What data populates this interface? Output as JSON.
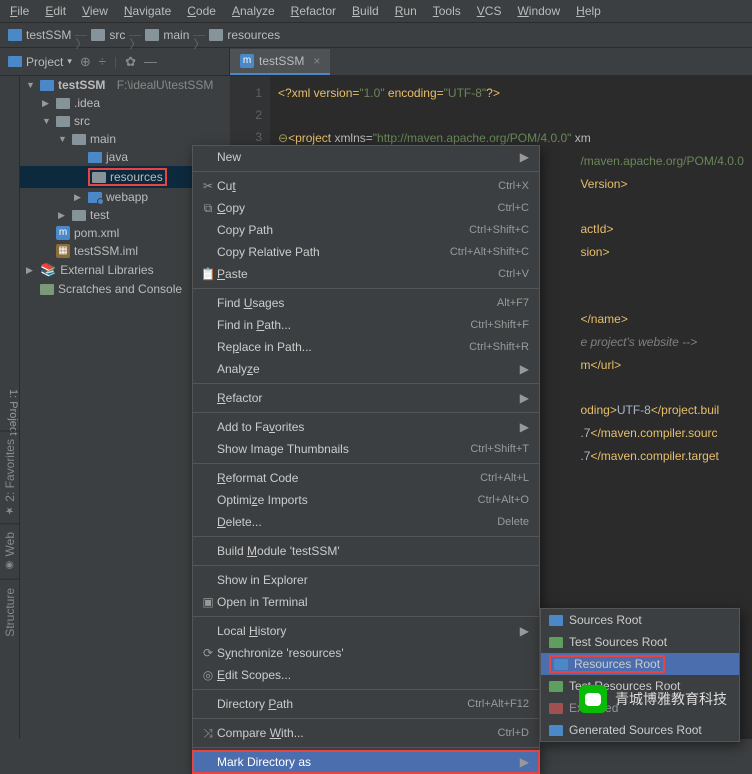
{
  "menubar": [
    "File",
    "Edit",
    "View",
    "Navigate",
    "Code",
    "Analyze",
    "Refactor",
    "Build",
    "Run",
    "Tools",
    "VCS",
    "Window",
    "Help"
  ],
  "breadcrumb": {
    "parts": [
      "testSSM",
      "src",
      "main",
      "resources"
    ]
  },
  "proj_toolbar": {
    "label": "Project"
  },
  "tab": {
    "label": "testSSM"
  },
  "tree": {
    "root": {
      "name": "testSSM",
      "path": "F:\\idealU\\testSSM"
    },
    "n_idea": ".idea",
    "n_src": "src",
    "n_main": "main",
    "n_java": "java",
    "n_resources": "resources",
    "n_webapp": "webapp",
    "n_test": "test",
    "n_pom": "pom.xml",
    "n_iml": "testSSM.iml",
    "n_ext": "External Libraries",
    "n_scr": "Scratches and Console"
  },
  "gutter": [
    "1",
    "2",
    "3"
  ],
  "code": {
    "l1_p": "<?",
    "l1_xml": "xml version=",
    "l1_v": "\"1.0\"",
    "l1_enc": " encoding=",
    "l1_u": "\"UTF-8\"",
    "l1_e": "?>",
    "l3_p": "<",
    "l3_proj": "project ",
    "l3_xmlns": "xmlns=",
    "l3_url": "\"http://maven.apache.org/POM/4.0.0\"",
    "l3_xm": " xm",
    "l4": "/maven.apache.org/POM/4.0.0",
    "l5_v": "Version>",
    "l7_a": "actId>",
    "l8_s": "sion>",
    "l11_n": "</name>",
    "l12_c": "e project's website ",
    "l12_e": "-->",
    "l13_u": "m</url>",
    "l15_od": "oding>",
    "l15_u": "UTF-8",
    "l15_pb": "</project.buil",
    "l16_7": ".7",
    "l16_mcs": "</maven.compiler.sourc",
    "l17_7": ".7",
    "l17_mct": "</maven.compiler.target"
  },
  "ctx": [
    {
      "lbl": "New",
      "arw": "▶"
    },
    {
      "sep": 1
    },
    {
      "icn": "✂",
      "lbl": "Cut",
      "sc": "Ctrl+X",
      "u": "t"
    },
    {
      "icn": "⧉",
      "lbl": "Copy",
      "sc": "Ctrl+C",
      "u": "C"
    },
    {
      "lbl": "Copy Path",
      "sc": "Ctrl+Shift+C"
    },
    {
      "lbl": "Copy Relative Path",
      "sc": "Ctrl+Alt+Shift+C"
    },
    {
      "icn": "📋",
      "lbl": "Paste",
      "sc": "Ctrl+V",
      "u": "P"
    },
    {
      "sep": 1
    },
    {
      "lbl": "Find Usages",
      "sc": "Alt+F7",
      "u": "U"
    },
    {
      "lbl": "Find in Path...",
      "sc": "Ctrl+Shift+F",
      "u": "P"
    },
    {
      "lbl": "Replace in Path...",
      "sc": "Ctrl+Shift+R",
      "u": "p"
    },
    {
      "lbl": "Analyze",
      "arw": "▶",
      "u": "z"
    },
    {
      "sep": 1
    },
    {
      "lbl": "Refactor",
      "arw": "▶",
      "u": "R"
    },
    {
      "sep": 1
    },
    {
      "lbl": "Add to Favorites",
      "arw": "▶",
      "u": "v"
    },
    {
      "lbl": "Show Image Thumbnails",
      "sc": "Ctrl+Shift+T"
    },
    {
      "sep": 1
    },
    {
      "lbl": "Reformat Code",
      "sc": "Ctrl+Alt+L",
      "u": "R"
    },
    {
      "lbl": "Optimize Imports",
      "sc": "Ctrl+Alt+O",
      "u": "z"
    },
    {
      "lbl": "Delete...",
      "sc": "Delete",
      "u": "D"
    },
    {
      "sep": 1
    },
    {
      "lbl": "Build Module 'testSSM'",
      "u": "M"
    },
    {
      "sep": 1
    },
    {
      "lbl": "Show in Explorer"
    },
    {
      "icn": "▣",
      "lbl": "Open in Terminal"
    },
    {
      "sep": 1
    },
    {
      "lbl": "Local History",
      "arw": "▶",
      "u": "H"
    },
    {
      "icn": "⟳",
      "lbl": "Synchronize 'resources'",
      "u": "y"
    },
    {
      "icn": "◎",
      "lbl": "Edit Scopes...",
      "u": "E"
    },
    {
      "sep": 1
    },
    {
      "lbl": "Directory Path",
      "sc": "Ctrl+Alt+F12",
      "u": "P"
    },
    {
      "sep": 1
    },
    {
      "icn": "⤨",
      "lbl": "Compare With...",
      "sc": "Ctrl+D",
      "u": "W"
    },
    {
      "sep": 1
    },
    {
      "lbl": "Mark Directory as",
      "arw": "▶",
      "sel": 1,
      "red": 1
    }
  ],
  "submenu": [
    {
      "lbl": "Sources Root",
      "c": "#4a88c7"
    },
    {
      "lbl": "Test Sources Root",
      "c": "#5e9e5e"
    },
    {
      "lbl": "Resources Root",
      "c": "#4a88c7",
      "hl": 1,
      "red": 1
    },
    {
      "lbl": "Test Resources Root",
      "c": "#5e9e5e"
    },
    {
      "lbl": "Excluded",
      "c": "#a05050",
      "dim": 1
    },
    {
      "lbl": "Generated Sources Root",
      "c": "#4a88c7"
    }
  ],
  "sidetabs": [
    "1: Project",
    "2: Favorites",
    "Web",
    "Structure"
  ],
  "wechat": "青城博雅教育科技"
}
